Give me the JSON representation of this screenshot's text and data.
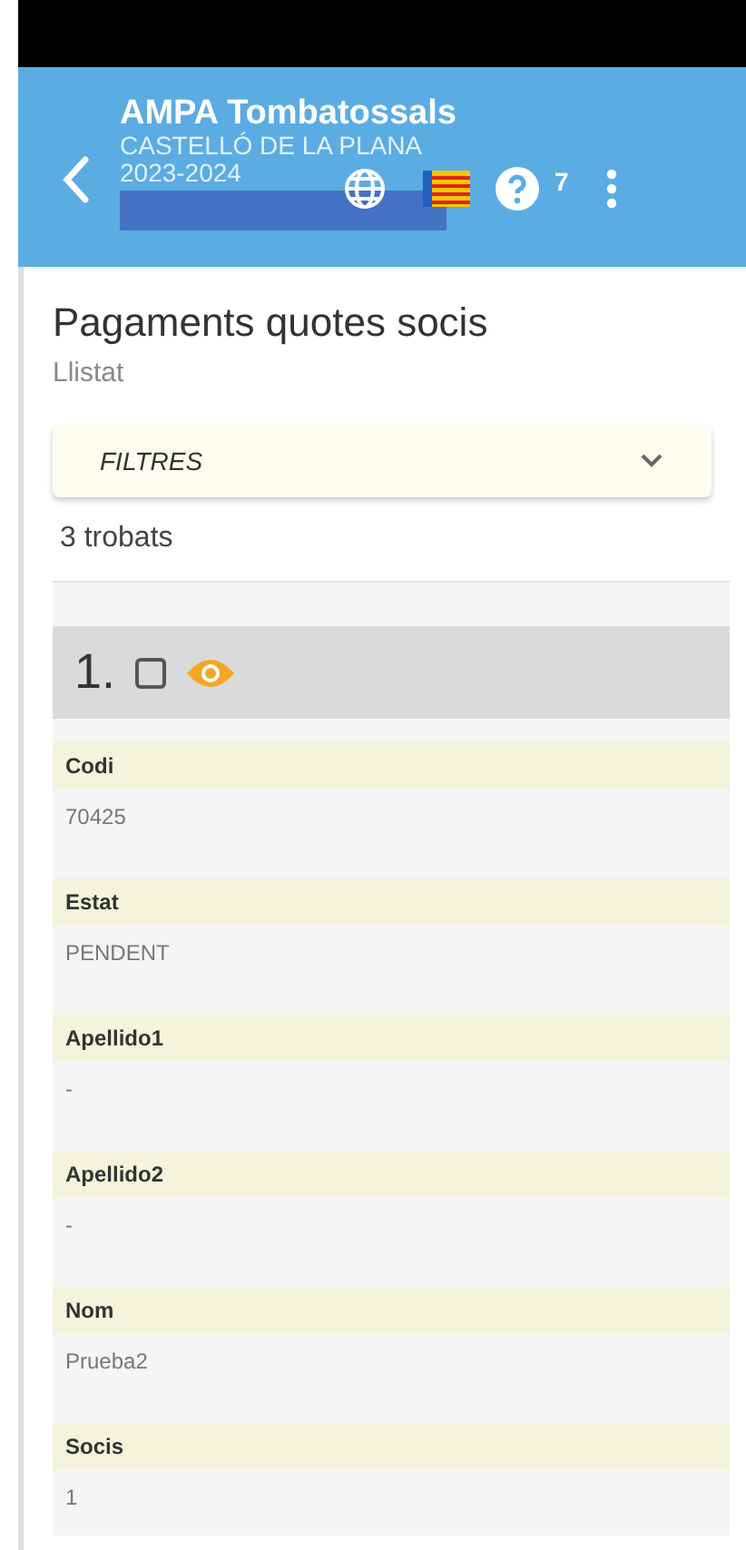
{
  "app_bar": {
    "title": "AMPA Tombatossals",
    "subtitle": "CASTELLÓ DE LA PLANA",
    "year": "2023-2024",
    "help_count": "7"
  },
  "page": {
    "title": "Pagaments quotes socis",
    "subtitle": "Llistat"
  },
  "filters": {
    "label": "FILTRES",
    "expanded": false
  },
  "result_count": "3 trobats",
  "record": {
    "number": "1.",
    "checked": false,
    "fields": [
      {
        "label": "Codi",
        "value": "70425"
      },
      {
        "label": "Estat",
        "value": "PENDENT"
      },
      {
        "label": "Apellido1",
        "value": "-"
      },
      {
        "label": "Apellido2",
        "value": "-"
      },
      {
        "label": "Nom",
        "value": "Prueba2"
      },
      {
        "label": "Socis",
        "value": "1"
      }
    ]
  }
}
